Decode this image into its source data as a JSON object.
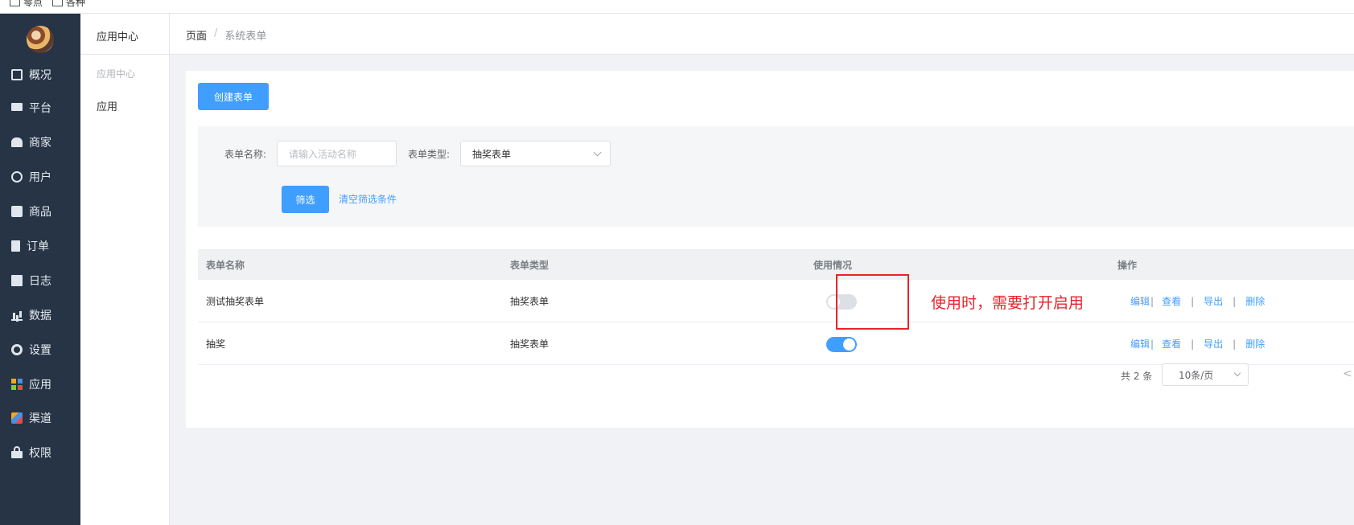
{
  "bookmarks": [
    {
      "label": "零点"
    },
    {
      "label": "各种"
    }
  ],
  "sidebar": {
    "items": [
      {
        "label": "概况",
        "icon": "dashboard-icon"
      },
      {
        "label": "平台",
        "icon": "monitor-icon"
      },
      {
        "label": "商家",
        "icon": "store-icon"
      },
      {
        "label": "用户",
        "icon": "user-icon"
      },
      {
        "label": "商品",
        "icon": "bag-icon"
      },
      {
        "label": "订单",
        "icon": "order-icon"
      },
      {
        "label": "日志",
        "icon": "log-icon"
      },
      {
        "label": "数据",
        "icon": "bar-chart-icon"
      },
      {
        "label": "设置",
        "icon": "gear-icon"
      },
      {
        "label": "应用",
        "icon": "apps-icon"
      },
      {
        "label": "渠道",
        "icon": "cube-icon"
      },
      {
        "label": "权限",
        "icon": "lock-icon"
      }
    ]
  },
  "subsidebar": {
    "title": "应用中心",
    "group": "应用中心",
    "item": "应用"
  },
  "breadcrumb": {
    "first": "页面",
    "separator": "/",
    "current": "系统表单"
  },
  "toolbar": {
    "create_label": "创建表单"
  },
  "filter": {
    "name_label": "表单名称:",
    "name_placeholder": "请输入活动名称",
    "type_label": "表单类型:",
    "type_value": "抽奖表单",
    "filter_label": "筛选",
    "clear_label": "清空筛选条件"
  },
  "table": {
    "headers": [
      "表单名称",
      "表单类型",
      "使用情况",
      "操作"
    ],
    "rows": [
      {
        "name": "测试抽奖表单",
        "type": "抽奖表单",
        "enabled": false
      },
      {
        "name": "抽奖",
        "type": "抽奖表单",
        "enabled": true
      }
    ],
    "actions": {
      "edit": "编辑",
      "view": "查看",
      "export": "导出",
      "delete": "删除",
      "separator": "|"
    }
  },
  "pagination": {
    "total": "共 2 条",
    "page_size": "10条/页",
    "prev": "<"
  },
  "annotation": {
    "text": "使用时，需要打开启用",
    "color": "#e8232b"
  },
  "colors": {
    "primary": "#409eff",
    "sidebar_bg": "#263445"
  }
}
